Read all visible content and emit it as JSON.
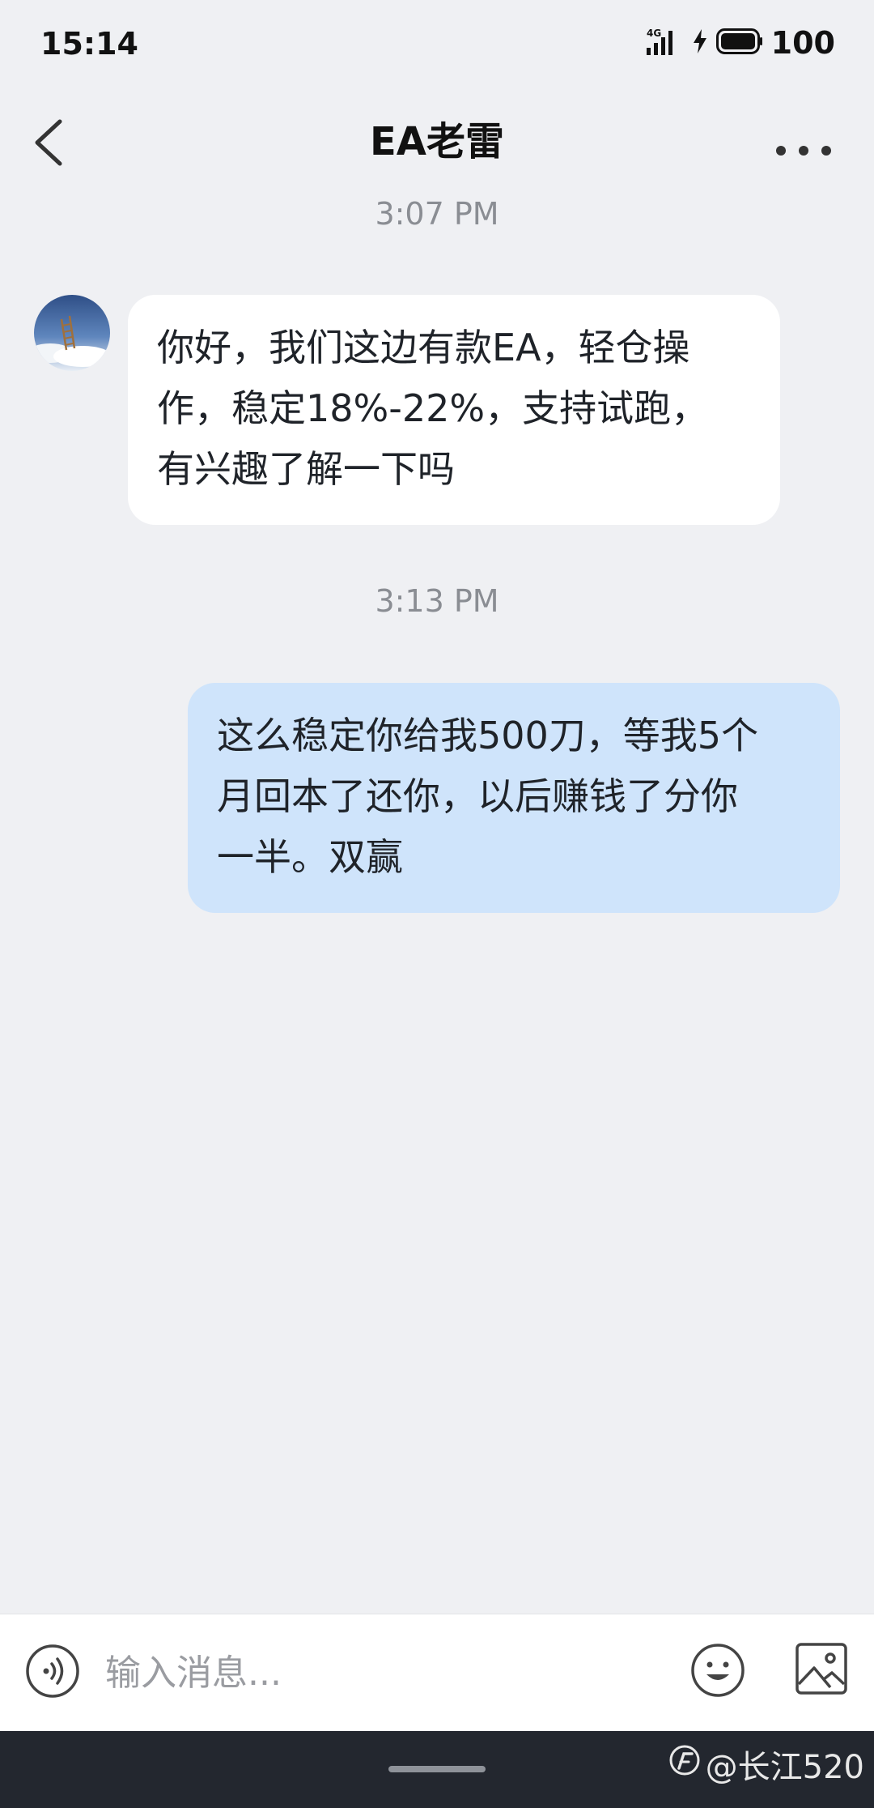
{
  "status_bar": {
    "time": "15:14",
    "network": "4G",
    "battery": "100"
  },
  "header": {
    "title": "EA老雷",
    "back_icon": "chevron-left-icon",
    "more_icon": "more-horizontal-icon"
  },
  "messages": [
    {
      "timestamp": "3:07 PM",
      "direction": "incoming",
      "lines": [
        "你好，我们这边有款EA，轻仓操",
        "作，稳定18%-22%，支持试跑，",
        "有兴趣了解一下吗"
      ]
    },
    {
      "timestamp": "3:13 PM",
      "direction": "outgoing",
      "lines": [
        "这么稳定你给我500刀，等我5个",
        "月回本了还你，以后赚钱了分你",
        "一半。双赢"
      ]
    }
  ],
  "input_bar": {
    "placeholder": "输入消息...",
    "voice_icon": "voice-icon",
    "emoji_icon": "emoji-icon",
    "image_icon": "image-icon"
  },
  "watermark": {
    "text": "@长江520"
  },
  "colors": {
    "background": "#eff0f3",
    "incoming_bubble": "#ffffff",
    "outgoing_bubble": "#cfe4fb",
    "nav_bar": "#23272f"
  }
}
